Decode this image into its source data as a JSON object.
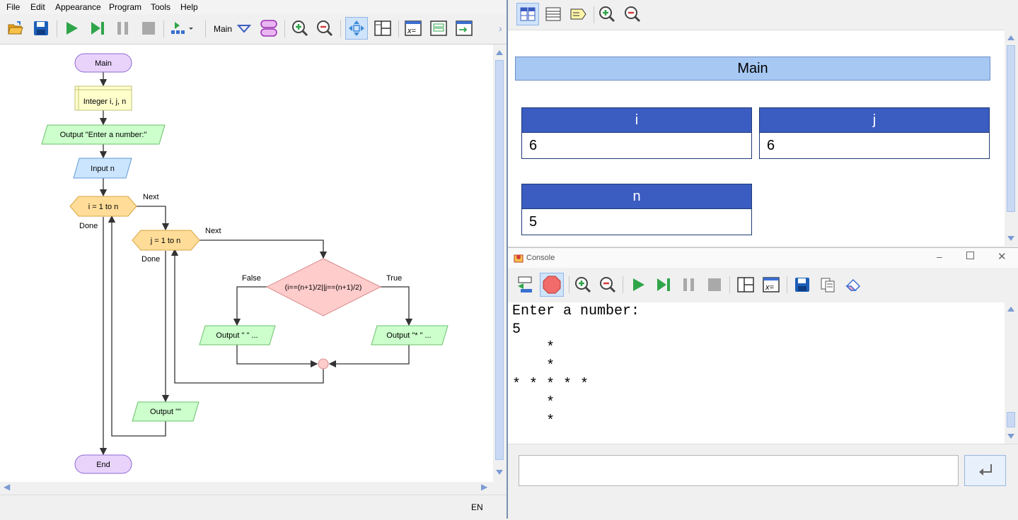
{
  "menu": [
    "File",
    "Edit",
    "Appearance",
    "Program",
    "Tools",
    "Help"
  ],
  "toolbar": {
    "function_selector": "Main",
    "icons": [
      "open-icon",
      "save-icon",
      "run-icon",
      "step-icon",
      "pause-icon",
      "stop-icon",
      "add-shape-icon",
      "function-menu-icon",
      "new-function-icon",
      "zoom-in-icon",
      "zoom-out-icon",
      "move-icon",
      "variables-window-icon",
      "expression-icon",
      "watch-icon",
      "console-window-icon"
    ]
  },
  "flowchart": {
    "start": "Main",
    "declare": "Integer i, j, n",
    "output_prompt": "Output \"Enter a number:\"",
    "input": "Input n",
    "outer_loop": "i = 1 to n",
    "outer_next": "Next",
    "outer_done": "Done",
    "inner_loop": "j = 1 to n",
    "inner_next": "Next",
    "inner_done": "Done",
    "condition": "(i==(n+1)/2||j==(n+1)/2)",
    "false_label": "False",
    "true_label": "True",
    "output_false": "Output \"  \" ...",
    "output_true": "Output \"* \" ...",
    "output_newline": "Output \"\"",
    "end": "End"
  },
  "status": {
    "language": "EN"
  },
  "variables": {
    "function_name": "Main",
    "items": [
      {
        "name": "i",
        "value": "6"
      },
      {
        "name": "j",
        "value": "6"
      },
      {
        "name": "n",
        "value": "5"
      }
    ]
  },
  "console": {
    "title": "Console",
    "output": "Enter a number:\n5\n    *\n    *\n* * * * *\n    *\n    *",
    "input_value": "",
    "colors": {
      "stop_button": "#f26b6b",
      "run_button": "#2fa54a"
    }
  }
}
